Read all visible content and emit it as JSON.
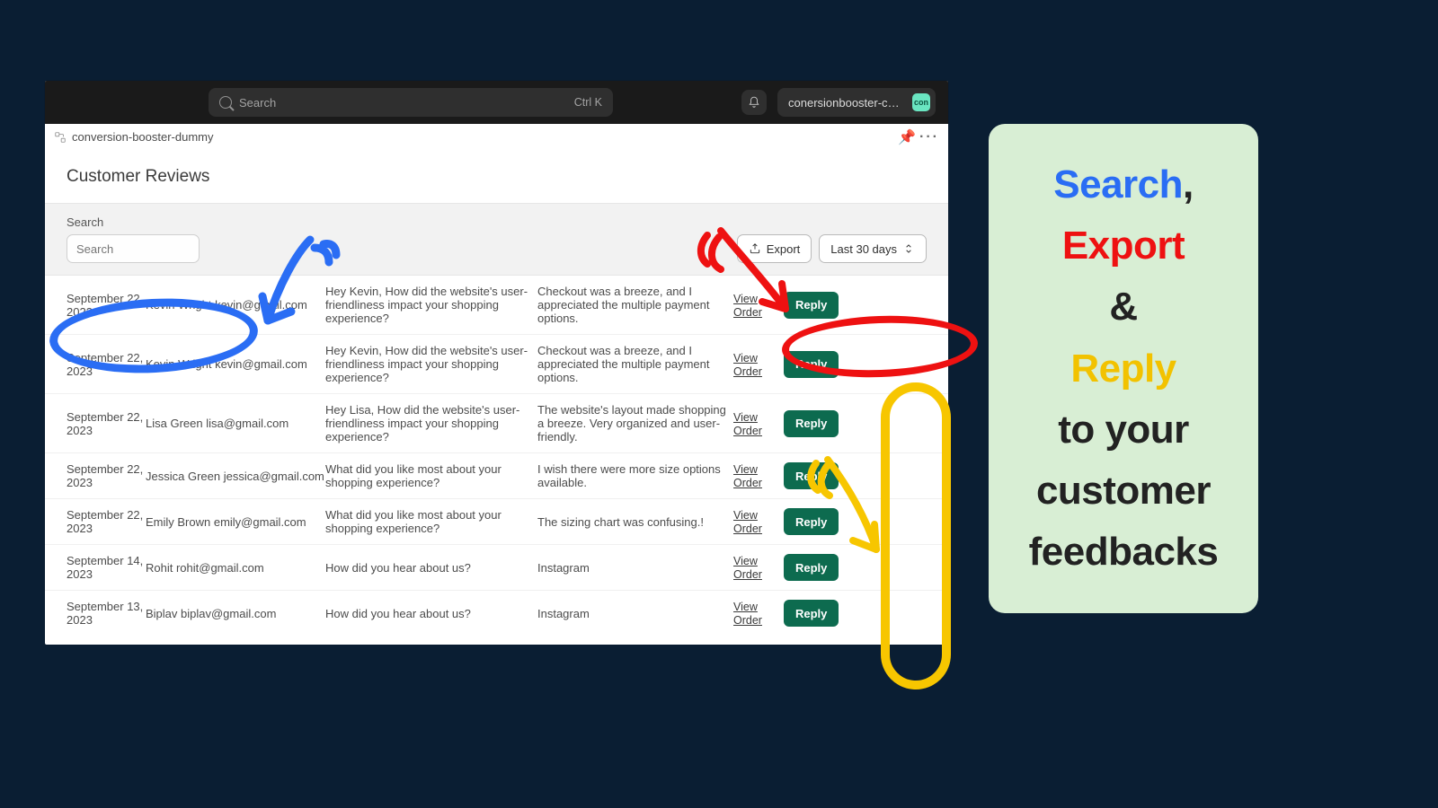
{
  "topbar": {
    "search_placeholder": "Search",
    "kbd": "Ctrl K",
    "store_name": "conersionbooster-che…",
    "store_badge": "con"
  },
  "breadcrumb": "conversion-booster-dummy",
  "page_title": "Customer Reviews",
  "search": {
    "label": "Search",
    "placeholder": "Search"
  },
  "buttons": {
    "export": "Export",
    "daterange": "Last 30 days",
    "reply": "Reply",
    "view_order": "View Order"
  },
  "rows": [
    {
      "date": "September 22, 2023",
      "customer": "Kevin Wright kevin@gmail.com",
      "question": "Hey Kevin, How did the website's user-friendliness impact your shopping experience?",
      "answer": "Checkout was a breeze, and I appreciated the multiple payment options."
    },
    {
      "date": "September 22, 2023",
      "customer": "Kevin Wright kevin@gmail.com",
      "question": "Hey Kevin, How did the website's user-friendliness impact your shopping experience?",
      "answer": "Checkout was a breeze, and I appreciated the multiple payment options."
    },
    {
      "date": "September 22, 2023",
      "customer": "Lisa Green lisa@gmail.com",
      "question": "Hey Lisa, How did the website's user-friendliness impact your shopping experience?",
      "answer": "The website's layout made shopping a breeze. Very organized and user-friendly."
    },
    {
      "date": "September 22, 2023",
      "customer": "Jessica Green jessica@gmail.com",
      "question": "What did you like most about your shopping experience?",
      "answer": "I wish there were more size options available."
    },
    {
      "date": "September 22, 2023",
      "customer": "Emily Brown emily@gmail.com",
      "question": "What did you like most about your shopping experience?",
      "answer": "The sizing chart was confusing.!"
    },
    {
      "date": "September 14, 2023",
      "customer": "Rohit rohit@gmail.com",
      "question": "How did you hear about us?",
      "answer": "Instagram"
    },
    {
      "date": "September 13, 2023",
      "customer": "Biplav biplav@gmail.com",
      "question": "How did you hear about us?",
      "answer": "Instagram"
    }
  ],
  "callout": {
    "search": "Search",
    "export": "Export",
    "amp": "&",
    "reply": "Reply",
    "rest1": "to your",
    "rest2": "customer",
    "rest3": "feedbacks"
  }
}
